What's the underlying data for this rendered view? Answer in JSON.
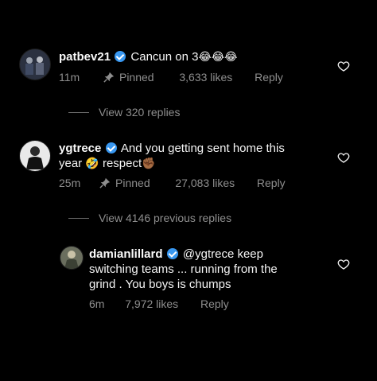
{
  "comments": [
    {
      "username": "patbev21",
      "text": "Cancun on 3",
      "emoji": "😂😂😂",
      "time": "11m",
      "pinned": "Pinned",
      "likes": "3,633 likes",
      "reply": "Reply"
    },
    {
      "username": "ygtrece",
      "text_line1": "And you getting sent home this",
      "text_line2_prefix": "year",
      "emoji_a": "🤣",
      "text_line2_suffix": "respect",
      "emoji_b": "✊🏾",
      "time": "25m",
      "pinned": "Pinned",
      "likes": "27,083 likes",
      "reply": "Reply"
    },
    {
      "username": "damianlillard",
      "text_line1": "@ygtrece keep",
      "text_line2": "switching teams ... running from the",
      "text_line3": "grind . You boys is chumps",
      "time": "6m",
      "likes": "7,972 likes",
      "reply": "Reply"
    }
  ],
  "view_replies_1": "View 320 replies",
  "view_replies_2": "View 4146 previous replies",
  "icons": {
    "verified": "verified-badge-icon",
    "pin": "pin-icon",
    "heart": "heart-outline-icon"
  },
  "colors": {
    "background": "#000000",
    "text": "#f5f5f5",
    "muted": "#8e8e8e",
    "verified": "#3897f0"
  }
}
